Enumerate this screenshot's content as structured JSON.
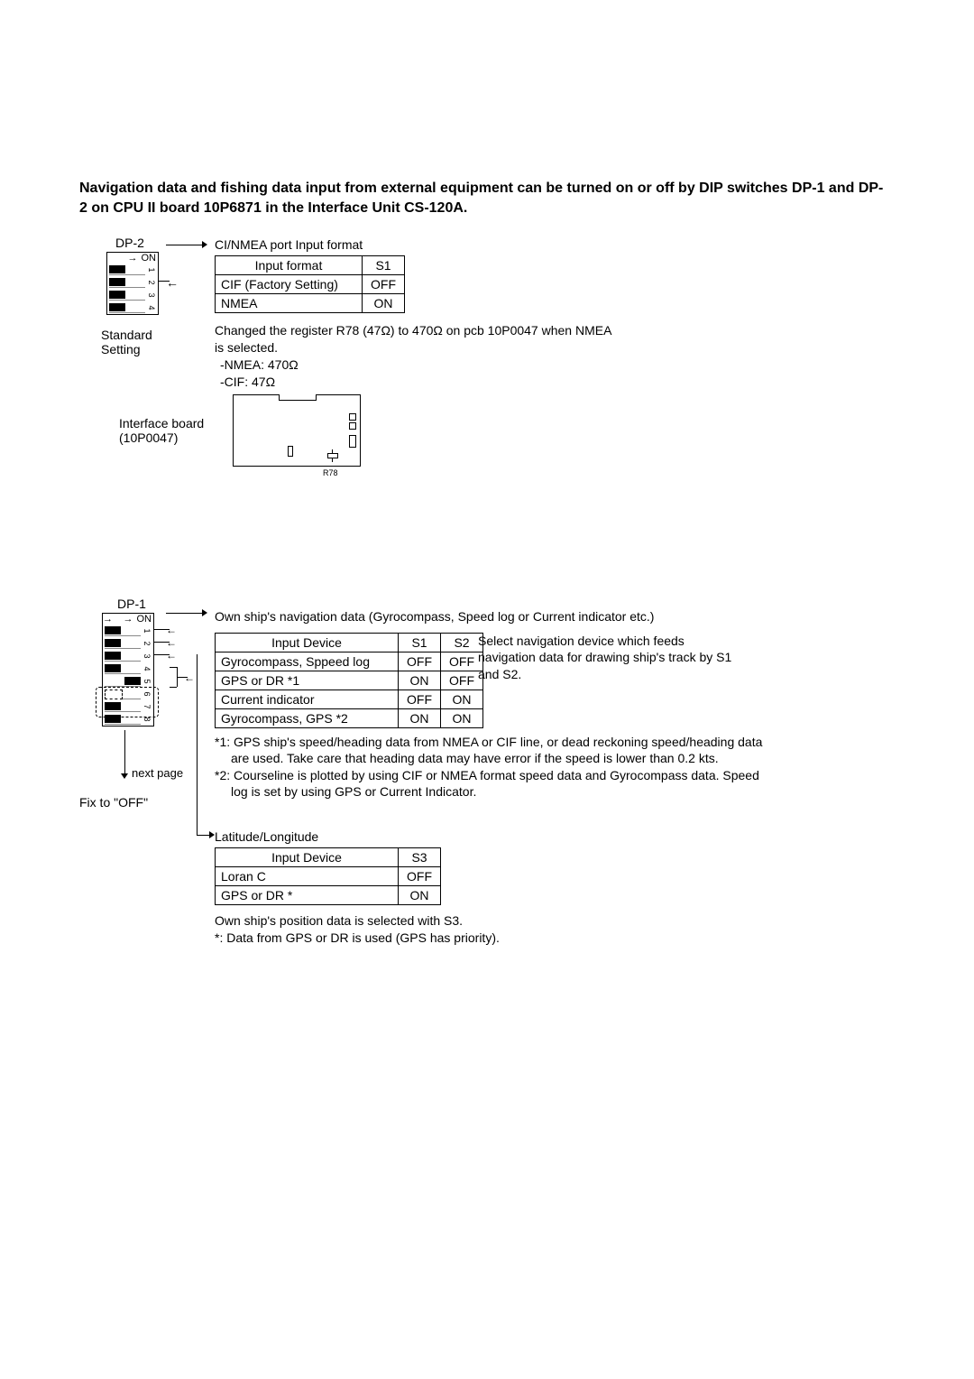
{
  "intro": "Navigation data and fishing data input from external equipment can be turned on or off by DIP switches DP-1 and DP-2 on CPU II board 10P6871 in the Interface Unit CS-120A.",
  "dp2": {
    "name": "DP-2",
    "standard_setting": "Standard Setting",
    "port_title": "CI/NMEA port Input format",
    "header_format": "Input format",
    "header_s1": "S1",
    "row1_name": "CIF (Factory Setting)",
    "row1_s1": "OFF",
    "row2_name": "NMEA",
    "row2_s1": "ON",
    "note1": "Changed the register R78 (47Ω) to 470Ω on pcb 10P0047 when NMEA is selected.",
    "note2": "-NMEA: 470Ω",
    "note3": "-CIF: 47Ω",
    "iface_label": "Interface board (10P0047)",
    "r78": "R78"
  },
  "dp1": {
    "name": "DP-1",
    "nav_title": "Own ship's navigation data (Gyrocompass, Speed log or Current indicator etc.)",
    "tbl1_h1": "Input Device",
    "tbl1_h2": "S1",
    "tbl1_h3": "S2",
    "tbl1_r1": "Gyrocompass, Sppeed log",
    "tbl1_r1s1": "OFF",
    "tbl1_r1s2": "OFF",
    "tbl1_r2": "GPS or DR  *1",
    "tbl1_r2s1": "ON",
    "tbl1_r2s2": "OFF",
    "tbl1_r3": "Current indicator",
    "tbl1_r3s1": "OFF",
    "tbl1_r3s2": "ON",
    "tbl1_r4": "Gyrocompass, GPS *2",
    "tbl1_r4s1": "ON",
    "tbl1_r4s2": "ON",
    "side_note": "Select navigation device which feeds navigation data for drawing ship's track by S1 and S2.",
    "foot1": "*1: GPS ship's speed/heading data from NMEA or CIF line, or dead reckoning speed/heading data are used. Take care that heading data may have error if the speed is lower than 0.2 kts.",
    "foot2": "*2: Courseline is plotted by using CIF or NMEA format speed data and Gyrocompass data. Speed log is set by using GPS or Current Indicator.",
    "latlon_title": "Latitude/Longitude",
    "tbl2_h1": "Input Device",
    "tbl2_h2": "S3",
    "tbl2_r1": "Loran C",
    "tbl2_r1s3": "OFF",
    "tbl2_r2": "GPS or DR *",
    "tbl2_r2s3": "ON",
    "latlon_note1": "Own ship's position data is selected with S3.",
    "latlon_note2": "*: Data from GPS or DR is used (GPS has priority).",
    "next_page": "next page",
    "fix_off": "Fix to \"OFF\""
  }
}
